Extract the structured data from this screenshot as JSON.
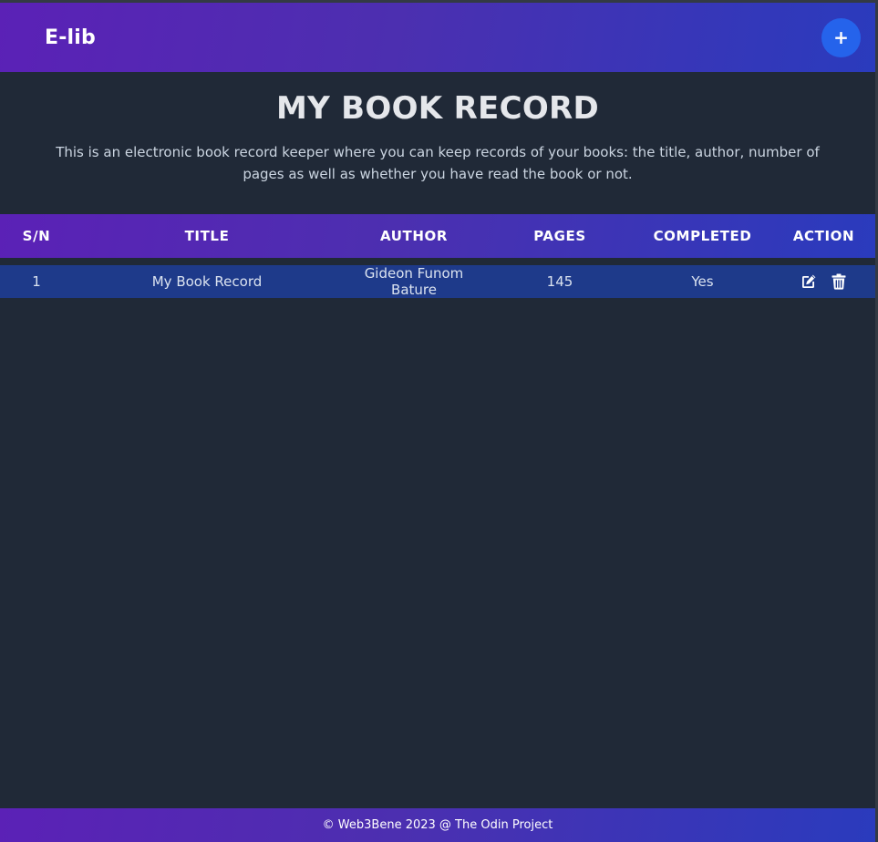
{
  "navbar": {
    "brand": "E-lib",
    "add_label": "+"
  },
  "hero": {
    "title": "MY BOOK RECORD",
    "description": "This is an electronic book record keeper where you can keep records of your books: the title, author, number of pages as well as whether you have read the book or not."
  },
  "table": {
    "headers": [
      "S/N",
      "TITLE",
      "AUTHOR",
      "PAGES",
      "COMPLETED",
      "ACTION"
    ],
    "rows": [
      {
        "sn": "1",
        "title": "My Book Record",
        "author": "Gideon Funom Bature",
        "pages": "145",
        "completed": "Yes",
        "actions": [
          "edit-icon",
          "trash-icon"
        ]
      }
    ]
  },
  "footer": {
    "text": "© Web3Bene 2023 @ The Odin Project"
  },
  "colors": {
    "background": "#202937",
    "gradient_start": "#5b21b6",
    "gradient_end": "#2a3bbd",
    "add_button": "#2563eb",
    "row_background": "#1e3a8a"
  }
}
